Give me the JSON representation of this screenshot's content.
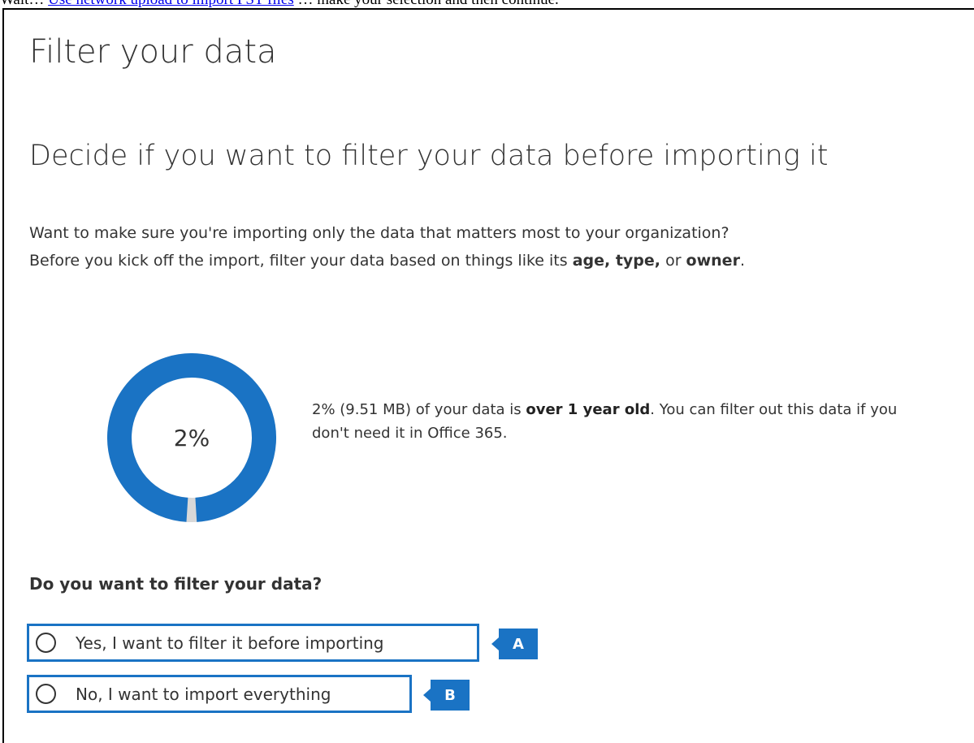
{
  "top_line": {
    "prefix": "Wait… ",
    "link": "Use network upload to import PST files",
    "suffix": " … make your selection and then continue."
  },
  "page_title": "Filter your data",
  "section_title": "Decide if you want to filter your data before importing it",
  "intro": {
    "line1": "Want to make sure you're importing only the data that matters most to your organization?",
    "line2_before": "Before you kick off the import, filter your data based on things like its ",
    "bold_age_type": "age, type,",
    "or": " or ",
    "bold_owner": "owner",
    "period": "."
  },
  "donut": {
    "label": "2%",
    "percent": 2,
    "color_main": "#1a73c4",
    "color_rest": "#d8d8d8"
  },
  "stat": {
    "before": "2% (9.51 MB) of your data is ",
    "bold": "over 1 year old",
    "after": ". You can filter out this data if you don't need it in Office 365."
  },
  "question": "Do you want to filter your data?",
  "options": [
    {
      "label": "Yes, I want to filter it before importing",
      "callout": "A"
    },
    {
      "label": "No, I want to import everything",
      "callout": "B"
    }
  ],
  "colors": {
    "accent": "#1a73c4",
    "text": "#333333"
  }
}
